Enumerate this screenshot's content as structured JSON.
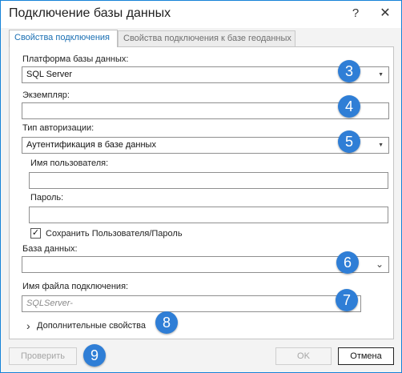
{
  "window": {
    "title": "Подключение базы данных",
    "help_glyph": "?",
    "close_glyph": "✕"
  },
  "tabs": [
    {
      "label": "Свойства подключения",
      "active": true
    },
    {
      "label": "Свойства подключения к базе геоданных",
      "active": false
    }
  ],
  "form": {
    "platform": {
      "label": "Платформа базы данных:",
      "value": "SQL Server",
      "arrow": "▼"
    },
    "instance": {
      "label": "Экземпляр:",
      "value": ""
    },
    "auth_type": {
      "label": "Тип авторизации:",
      "value": "Аутентификация в базе данных",
      "arrow": "▼"
    },
    "username": {
      "label": "Имя пользователя:",
      "value": ""
    },
    "password": {
      "label": "Пароль:",
      "value": ""
    },
    "save_credentials": {
      "label": "Сохранить Пользователя/Пароль",
      "checked": true,
      "check_glyph": "✓"
    },
    "database": {
      "label": "База данных:",
      "value": "",
      "arrow": "⌄"
    },
    "connection_file": {
      "label": "Имя файла подключения:",
      "placeholder": "SQLServer-"
    },
    "advanced": {
      "label": "Дополнительные свойства",
      "chevron": "›"
    }
  },
  "buttons": {
    "validate": "Проверить",
    "ok": "OK",
    "cancel": "Отмена"
  },
  "badges": [
    "3",
    "4",
    "5",
    "6",
    "7",
    "8",
    "9"
  ],
  "colors": {
    "accent": "#1683d8",
    "badge": "#2f7ed6",
    "active_tab_text": "#1a6fb3"
  }
}
